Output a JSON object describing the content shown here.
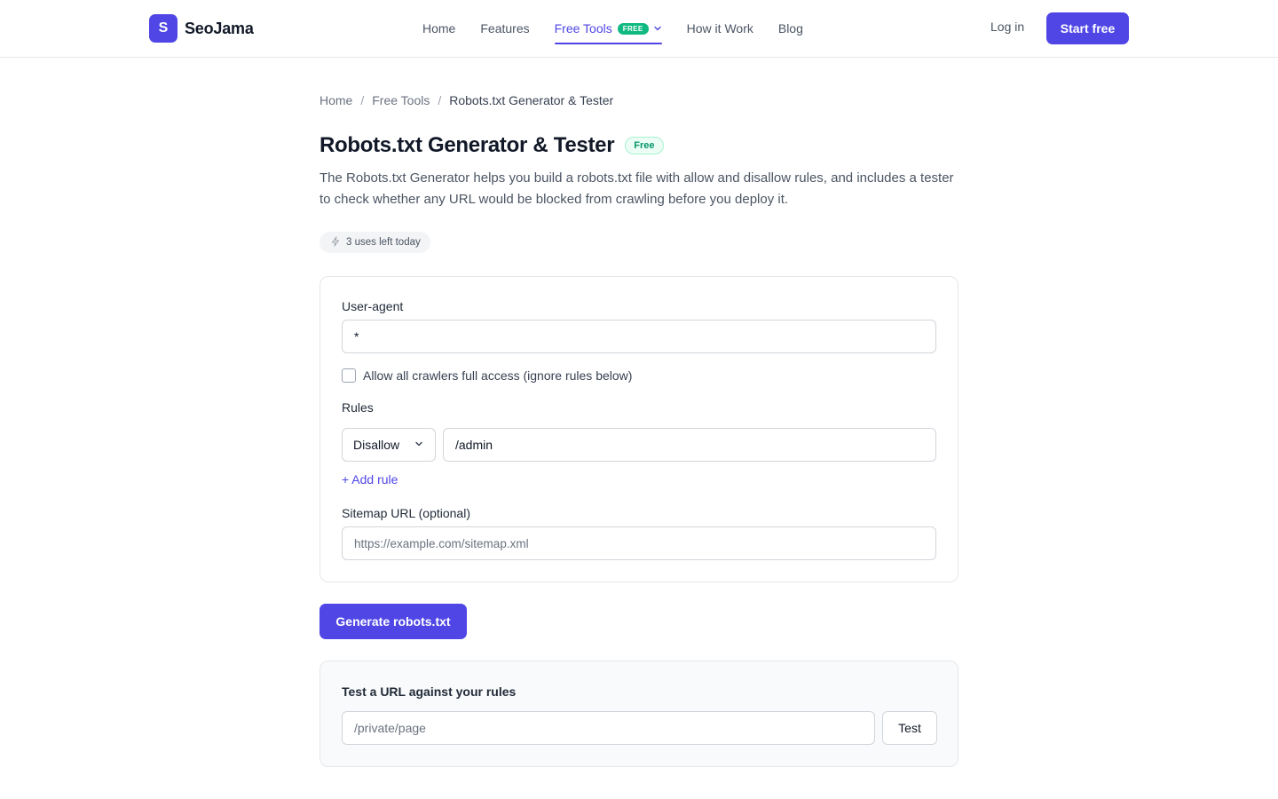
{
  "header": {
    "logo_letter": "S",
    "brand": "SeoJama",
    "nav": [
      {
        "label": "Home"
      },
      {
        "label": "Features"
      },
      {
        "label": "Free Tools",
        "badge": "FREE",
        "active": true
      },
      {
        "label": "How it Work"
      },
      {
        "label": "Blog"
      }
    ],
    "login_label": "Log in",
    "start_label": "Start free"
  },
  "breadcrumb": {
    "items": [
      "Home",
      "Free Tools"
    ],
    "current": "Robots.txt Generator & Tester",
    "separator": "/"
  },
  "page": {
    "title": "Robots.txt Generator & Tester",
    "title_badge": "Free",
    "description": "The Robots.txt Generator helps you build a robots.txt file with allow and disallow rules, and includes a tester to check whether any URL would be blocked from crawling before you deploy it.",
    "uses_left": "3 uses left today"
  },
  "form": {
    "user_agent_label": "User-agent",
    "user_agent_value": "*",
    "allow_all_label": "Allow all crawlers full access (ignore rules below)",
    "allow_all_checked": false,
    "rules_label": "Rules",
    "rules": [
      {
        "type": "Disallow",
        "path": "/admin"
      }
    ],
    "add_rule_label": "+ Add rule",
    "sitemap_label": "Sitemap URL (optional)",
    "sitemap_placeholder": "https://example.com/sitemap.xml",
    "sitemap_value": ""
  },
  "generate_label": "Generate robots.txt",
  "tester": {
    "title": "Test a URL against your rules",
    "placeholder": "/private/page",
    "button_label": "Test"
  },
  "colors": {
    "accent": "#4f46e5",
    "free_badge": "#10b981"
  }
}
